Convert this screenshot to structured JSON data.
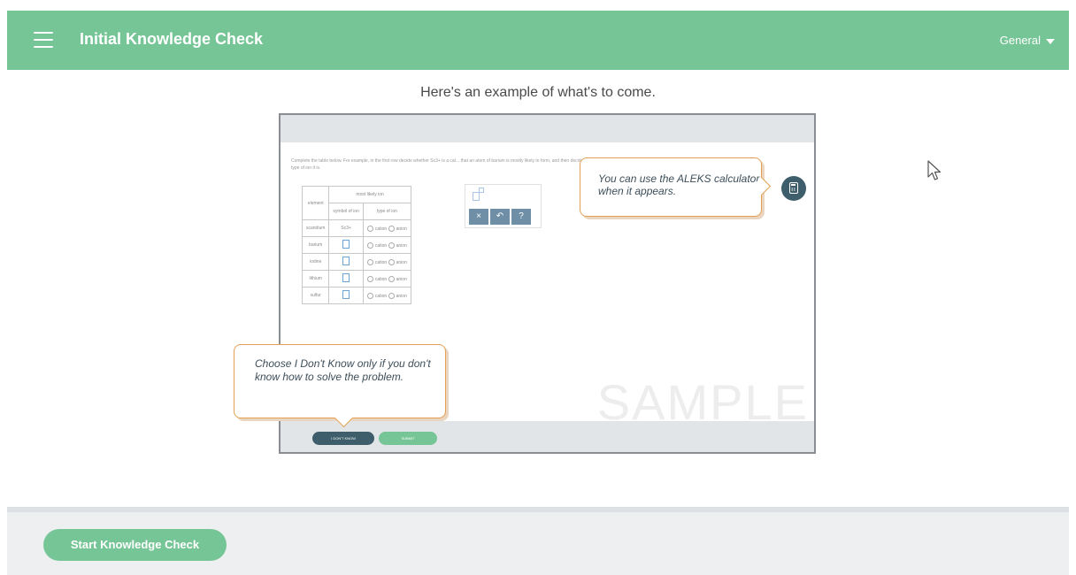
{
  "header": {
    "title": "Initial Knowledge Check",
    "menu_label": "General",
    "menu_icon": "hamburger-icon"
  },
  "intro": {
    "headline": "Here's an example of what's to come."
  },
  "sample": {
    "instructions": "Complete the table below. For example, in the first row decide whether Sc3+ is a cat... that an atom of barium is mostly likely to form, and then decide what type of ion it is.",
    "table": {
      "col_element": "element",
      "col_group": "most likely ion",
      "col_symbol": "symbol of ion",
      "col_type": "type of ion",
      "option_cation": "cation",
      "option_anion": "anion",
      "rows": [
        {
          "element": "scandium",
          "symbol": "Sc3+"
        },
        {
          "element": "barium",
          "symbol": ""
        },
        {
          "element": "iodine",
          "symbol": ""
        },
        {
          "element": "lithium",
          "symbol": ""
        },
        {
          "element": "sulfur",
          "symbol": ""
        }
      ]
    },
    "tools": [
      "×",
      "↶",
      "?"
    ],
    "watermark": "SAMPLE",
    "dont_know_label": "I DON'T KNOW",
    "submit_label": "SUBMIT",
    "calculator_icon": "calculator-icon"
  },
  "callouts": {
    "calculator": "You can use the ALEKS calculator when it appears.",
    "dont_know": "Choose I Don't Know only if you don't know how to solve the problem."
  },
  "footer": {
    "start_label": "Start Knowledge Check"
  },
  "colors": {
    "brand_green": "#76c596",
    "dark_slate": "#3d5e6a",
    "callout_border": "#e3a052"
  }
}
